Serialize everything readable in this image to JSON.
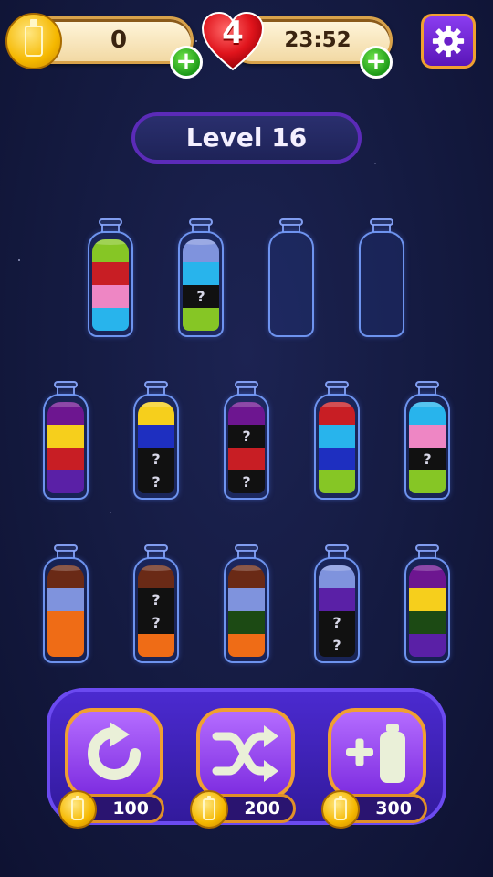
{
  "top_bar": {
    "coins": "0",
    "lives": "4",
    "timer": "23:52",
    "coin_icon": "coin-bottle-icon",
    "add_icon": "plus-icon",
    "heart_icon": "heart-icon",
    "settings_icon": "gear-icon"
  },
  "level": {
    "label": "Level 16"
  },
  "colors": {
    "green": "#86c625",
    "red": "#c81e24",
    "pink": "#ee86c4",
    "cyan": "#28b4ec",
    "periwinkle": "#7f93dd",
    "purple": "#6d1690",
    "violet": "#5a20a6",
    "yellow": "#f6cf1c",
    "blue": "#1e2fc0",
    "brown": "#6a2a16",
    "orange": "#ef6c16",
    "darkgreen": "#1c4a14",
    "unknown": "#111111",
    "accent_orange": "#f0a030",
    "panel_purple": "#4b2ad0"
  },
  "bottles": [
    {
      "layers_bottom_to_top": [
        "cyan",
        "pink",
        "red",
        "green"
      ]
    },
    {
      "layers_bottom_to_top": [
        "green",
        "unknown",
        "cyan",
        "periwinkle"
      ]
    },
    {
      "layers_bottom_to_top": []
    },
    {
      "layers_bottom_to_top": []
    },
    {
      "layers_bottom_to_top": [
        "violet",
        "red",
        "yellow",
        "purple"
      ]
    },
    {
      "layers_bottom_to_top": [
        "unknown",
        "unknown",
        "blue",
        "yellow"
      ]
    },
    {
      "layers_bottom_to_top": [
        "unknown",
        "red",
        "unknown",
        "purple"
      ]
    },
    {
      "layers_bottom_to_top": [
        "green",
        "blue",
        "cyan",
        "red"
      ]
    },
    {
      "layers_bottom_to_top": [
        "green",
        "unknown",
        "pink",
        "cyan"
      ]
    },
    {
      "layers_bottom_to_top": [
        "orange",
        "orange",
        "periwinkle",
        "brown"
      ]
    },
    {
      "layers_bottom_to_top": [
        "orange",
        "unknown",
        "unknown",
        "brown"
      ]
    },
    {
      "layers_bottom_to_top": [
        "orange",
        "darkgreen",
        "periwinkle",
        "brown"
      ]
    },
    {
      "layers_bottom_to_top": [
        "unknown",
        "unknown",
        "violet",
        "periwinkle"
      ]
    },
    {
      "layers_bottom_to_top": [
        "violet",
        "darkgreen",
        "yellow",
        "purple"
      ]
    }
  ],
  "unknown_mark": "?",
  "actions": [
    {
      "name": "undo",
      "icon": "undo-icon",
      "cost": "100"
    },
    {
      "name": "shuffle",
      "icon": "shuffle-icon",
      "cost": "200"
    },
    {
      "name": "add-bottle",
      "icon": "add-bottle-icon",
      "cost": "300"
    }
  ]
}
